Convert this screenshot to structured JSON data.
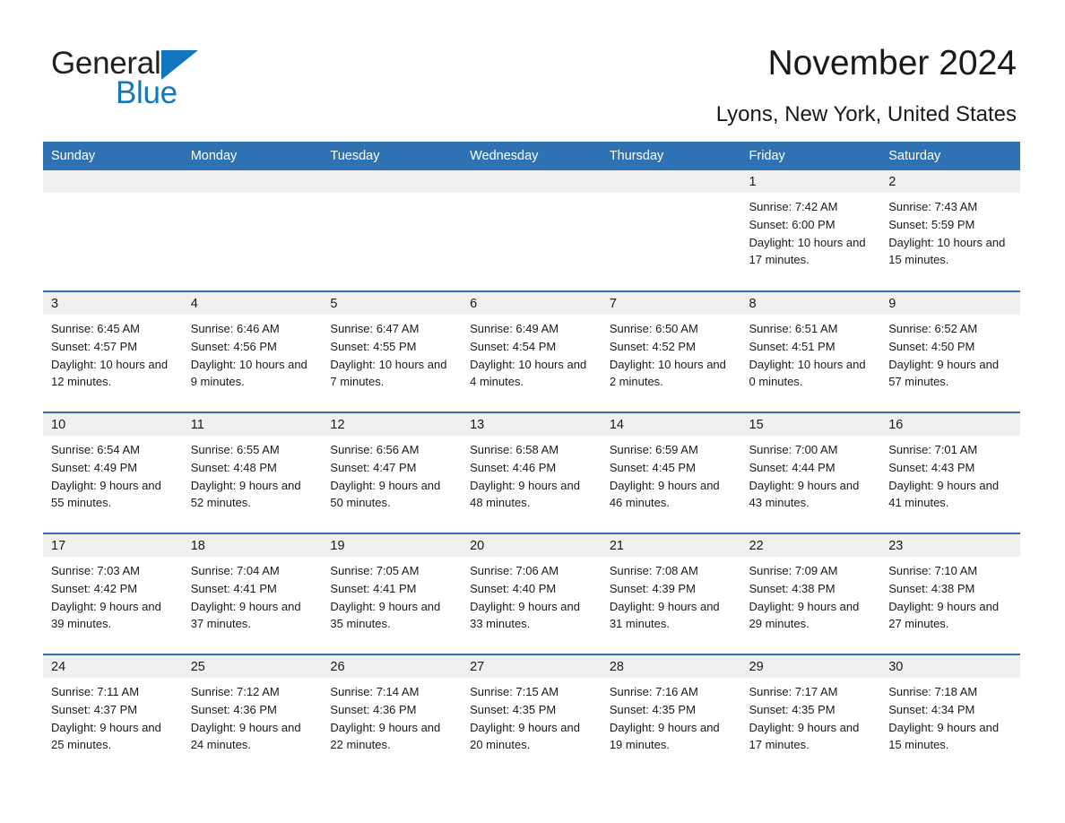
{
  "logo": {
    "part1": "General",
    "part2": "Blue",
    "triangle_color": "#1277bf"
  },
  "header": {
    "title": "November 2024",
    "location": "Lyons, New York, United States"
  },
  "theme": {
    "header_blue": "#2f72b4",
    "daynum_band": "#f0f0f0",
    "text": "#1a1a1a"
  },
  "calendar": {
    "weekday_headers": [
      "Sunday",
      "Monday",
      "Tuesday",
      "Wednesday",
      "Thursday",
      "Friday",
      "Saturday"
    ],
    "weeks": [
      [
        {
          "day": "",
          "sunrise": "",
          "sunset": "",
          "daylight": "",
          "empty": true
        },
        {
          "day": "",
          "sunrise": "",
          "sunset": "",
          "daylight": "",
          "empty": true
        },
        {
          "day": "",
          "sunrise": "",
          "sunset": "",
          "daylight": "",
          "empty": true
        },
        {
          "day": "",
          "sunrise": "",
          "sunset": "",
          "daylight": "",
          "empty": true
        },
        {
          "day": "",
          "sunrise": "",
          "sunset": "",
          "daylight": "",
          "empty": true
        },
        {
          "day": "1",
          "sunrise": "Sunrise: 7:42 AM",
          "sunset": "Sunset: 6:00 PM",
          "daylight": "Daylight: 10 hours and 17 minutes.",
          "empty": false
        },
        {
          "day": "2",
          "sunrise": "Sunrise: 7:43 AM",
          "sunset": "Sunset: 5:59 PM",
          "daylight": "Daylight: 10 hours and 15 minutes.",
          "empty": false
        }
      ],
      [
        {
          "day": "3",
          "sunrise": "Sunrise: 6:45 AM",
          "sunset": "Sunset: 4:57 PM",
          "daylight": "Daylight: 10 hours and 12 minutes.",
          "empty": false
        },
        {
          "day": "4",
          "sunrise": "Sunrise: 6:46 AM",
          "sunset": "Sunset: 4:56 PM",
          "daylight": "Daylight: 10 hours and 9 minutes.",
          "empty": false
        },
        {
          "day": "5",
          "sunrise": "Sunrise: 6:47 AM",
          "sunset": "Sunset: 4:55 PM",
          "daylight": "Daylight: 10 hours and 7 minutes.",
          "empty": false
        },
        {
          "day": "6",
          "sunrise": "Sunrise: 6:49 AM",
          "sunset": "Sunset: 4:54 PM",
          "daylight": "Daylight: 10 hours and 4 minutes.",
          "empty": false
        },
        {
          "day": "7",
          "sunrise": "Sunrise: 6:50 AM",
          "sunset": "Sunset: 4:52 PM",
          "daylight": "Daylight: 10 hours and 2 minutes.",
          "empty": false
        },
        {
          "day": "8",
          "sunrise": "Sunrise: 6:51 AM",
          "sunset": "Sunset: 4:51 PM",
          "daylight": "Daylight: 10 hours and 0 minutes.",
          "empty": false
        },
        {
          "day": "9",
          "sunrise": "Sunrise: 6:52 AM",
          "sunset": "Sunset: 4:50 PM",
          "daylight": "Daylight: 9 hours and 57 minutes.",
          "empty": false
        }
      ],
      [
        {
          "day": "10",
          "sunrise": "Sunrise: 6:54 AM",
          "sunset": "Sunset: 4:49 PM",
          "daylight": "Daylight: 9 hours and 55 minutes.",
          "empty": false
        },
        {
          "day": "11",
          "sunrise": "Sunrise: 6:55 AM",
          "sunset": "Sunset: 4:48 PM",
          "daylight": "Daylight: 9 hours and 52 minutes.",
          "empty": false
        },
        {
          "day": "12",
          "sunrise": "Sunrise: 6:56 AM",
          "sunset": "Sunset: 4:47 PM",
          "daylight": "Daylight: 9 hours and 50 minutes.",
          "empty": false
        },
        {
          "day": "13",
          "sunrise": "Sunrise: 6:58 AM",
          "sunset": "Sunset: 4:46 PM",
          "daylight": "Daylight: 9 hours and 48 minutes.",
          "empty": false
        },
        {
          "day": "14",
          "sunrise": "Sunrise: 6:59 AM",
          "sunset": "Sunset: 4:45 PM",
          "daylight": "Daylight: 9 hours and 46 minutes.",
          "empty": false
        },
        {
          "day": "15",
          "sunrise": "Sunrise: 7:00 AM",
          "sunset": "Sunset: 4:44 PM",
          "daylight": "Daylight: 9 hours and 43 minutes.",
          "empty": false
        },
        {
          "day": "16",
          "sunrise": "Sunrise: 7:01 AM",
          "sunset": "Sunset: 4:43 PM",
          "daylight": "Daylight: 9 hours and 41 minutes.",
          "empty": false
        }
      ],
      [
        {
          "day": "17",
          "sunrise": "Sunrise: 7:03 AM",
          "sunset": "Sunset: 4:42 PM",
          "daylight": "Daylight: 9 hours and 39 minutes.",
          "empty": false
        },
        {
          "day": "18",
          "sunrise": "Sunrise: 7:04 AM",
          "sunset": "Sunset: 4:41 PM",
          "daylight": "Daylight: 9 hours and 37 minutes.",
          "empty": false
        },
        {
          "day": "19",
          "sunrise": "Sunrise: 7:05 AM",
          "sunset": "Sunset: 4:41 PM",
          "daylight": "Daylight: 9 hours and 35 minutes.",
          "empty": false
        },
        {
          "day": "20",
          "sunrise": "Sunrise: 7:06 AM",
          "sunset": "Sunset: 4:40 PM",
          "daylight": "Daylight: 9 hours and 33 minutes.",
          "empty": false
        },
        {
          "day": "21",
          "sunrise": "Sunrise: 7:08 AM",
          "sunset": "Sunset: 4:39 PM",
          "daylight": "Daylight: 9 hours and 31 minutes.",
          "empty": false
        },
        {
          "day": "22",
          "sunrise": "Sunrise: 7:09 AM",
          "sunset": "Sunset: 4:38 PM",
          "daylight": "Daylight: 9 hours and 29 minutes.",
          "empty": false
        },
        {
          "day": "23",
          "sunrise": "Sunrise: 7:10 AM",
          "sunset": "Sunset: 4:38 PM",
          "daylight": "Daylight: 9 hours and 27 minutes.",
          "empty": false
        }
      ],
      [
        {
          "day": "24",
          "sunrise": "Sunrise: 7:11 AM",
          "sunset": "Sunset: 4:37 PM",
          "daylight": "Daylight: 9 hours and 25 minutes.",
          "empty": false
        },
        {
          "day": "25",
          "sunrise": "Sunrise: 7:12 AM",
          "sunset": "Sunset: 4:36 PM",
          "daylight": "Daylight: 9 hours and 24 minutes.",
          "empty": false
        },
        {
          "day": "26",
          "sunrise": "Sunrise: 7:14 AM",
          "sunset": "Sunset: 4:36 PM",
          "daylight": "Daylight: 9 hours and 22 minutes.",
          "empty": false
        },
        {
          "day": "27",
          "sunrise": "Sunrise: 7:15 AM",
          "sunset": "Sunset: 4:35 PM",
          "daylight": "Daylight: 9 hours and 20 minutes.",
          "empty": false
        },
        {
          "day": "28",
          "sunrise": "Sunrise: 7:16 AM",
          "sunset": "Sunset: 4:35 PM",
          "daylight": "Daylight: 9 hours and 19 minutes.",
          "empty": false
        },
        {
          "day": "29",
          "sunrise": "Sunrise: 7:17 AM",
          "sunset": "Sunset: 4:35 PM",
          "daylight": "Daylight: 9 hours and 17 minutes.",
          "empty": false
        },
        {
          "day": "30",
          "sunrise": "Sunrise: 7:18 AM",
          "sunset": "Sunset: 4:34 PM",
          "daylight": "Daylight: 9 hours and 15 minutes.",
          "empty": false
        }
      ]
    ]
  }
}
